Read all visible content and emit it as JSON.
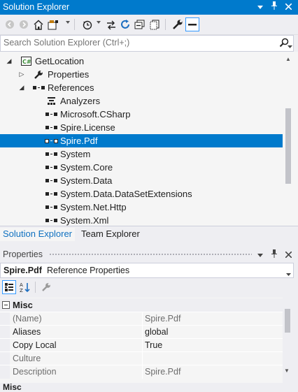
{
  "solution_explorer": {
    "title": "Solution Explorer",
    "title_buttons": [
      "dropdown-icon",
      "pin-icon",
      "close-icon"
    ],
    "toolbar_icons": [
      "back-icon",
      "forward-icon",
      "home-icon",
      "switch-views-icon",
      "pending-changes-filter-icon",
      "sync-with-active-document-icon",
      "refresh-icon",
      "collapse-all-icon",
      "show-all-files-icon",
      "properties-icon",
      "preview-selected-items-icon"
    ],
    "search": {
      "placeholder": "Search Solution Explorer (Ctrl+;)"
    },
    "tree": [
      {
        "label": "GetLocation",
        "icon": "csharp-project-icon",
        "expanded": true
      },
      {
        "label": "Properties",
        "icon": "wrench-icon",
        "expanded": false
      },
      {
        "label": "References",
        "icon": "references-icon",
        "expanded": true
      },
      {
        "label": "Analyzers",
        "icon": "analyzers-icon"
      },
      {
        "label": "Microsoft.CSharp",
        "icon": "reference-icon"
      },
      {
        "label": "Spire.License",
        "icon": "reference-icon"
      },
      {
        "label": "Spire.Pdf",
        "icon": "reference-icon",
        "selected": true
      },
      {
        "label": "System",
        "icon": "reference-icon"
      },
      {
        "label": "System.Core",
        "icon": "reference-icon"
      },
      {
        "label": "System.Data",
        "icon": "reference-icon"
      },
      {
        "label": "System.Data.DataSetExtensions",
        "icon": "reference-icon"
      },
      {
        "label": "System.Net.Http",
        "icon": "reference-icon"
      },
      {
        "label": "System.Xml",
        "icon": "reference-icon"
      }
    ],
    "tabs": [
      {
        "label": "Solution Explorer",
        "active": true
      },
      {
        "label": "Team Explorer",
        "active": false
      }
    ]
  },
  "properties": {
    "title": "Properties",
    "object_name": "Spire.Pdf",
    "object_type": "Reference Properties",
    "category": "Misc",
    "rows": [
      {
        "key": "(Name)",
        "value": "Spire.Pdf",
        "readonly": true
      },
      {
        "key": "Aliases",
        "value": "global",
        "readonly": false
      },
      {
        "key": "Copy Local",
        "value": "True",
        "readonly": false
      },
      {
        "key": "Culture",
        "value": "",
        "readonly": true
      },
      {
        "key": "Description",
        "value": "Spire.Pdf",
        "readonly": true
      }
    ],
    "bottom_cutoff_label": "Misc"
  },
  "colors": {
    "accent": "#007acc",
    "selection": "#007acc",
    "panel": "#f5f5f5",
    "chrome": "#eeeef2"
  }
}
